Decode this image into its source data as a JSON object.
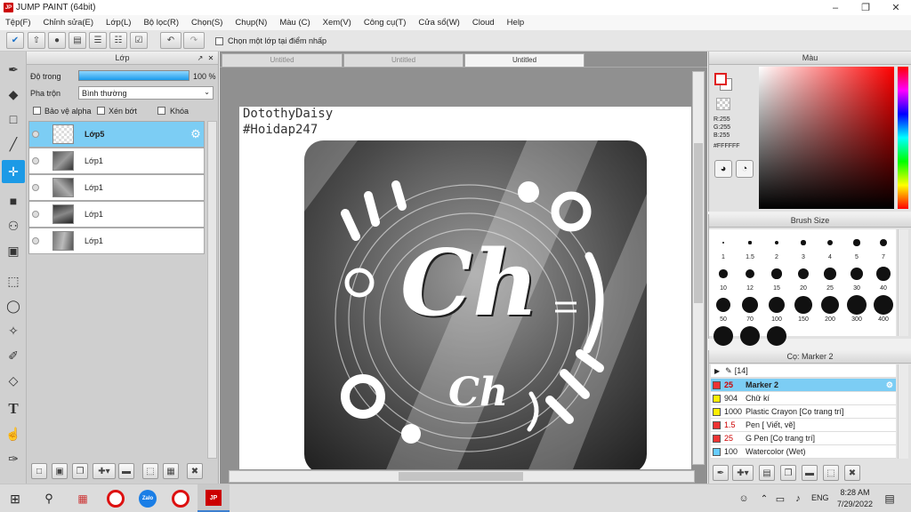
{
  "app": {
    "title": "JUMP PAINT (64bit)",
    "logo_text": "JP"
  },
  "menu": [
    "Tệp(F)",
    "Chỉnh sửa(E)",
    "Lớp(L)",
    "Bộ lọc(R)",
    "Chọn(S)",
    "Chụp(N)",
    "Màu (C)",
    "Xem(V)",
    "Công cụ(T)",
    "Cửa sổ(W)",
    "Cloud",
    "Help"
  ],
  "toolbar": {
    "sample_label": "Chọn một lớp tại điểm nhấp"
  },
  "layer_panel": {
    "title": "Lớp",
    "opacity_label": "Độ trong",
    "opacity_value": "100 %",
    "opacity_level": 1.0,
    "blend_label": "Pha trộn",
    "blend_value": "Bình thường",
    "protect_alpha": "Bảo vệ alpha",
    "clipping": "Xén bớt",
    "lock": "Khóa",
    "layers": [
      {
        "name": "Lớp5"
      },
      {
        "name": "Lớp1"
      },
      {
        "name": "Lớp1"
      },
      {
        "name": "Lớp1"
      },
      {
        "name": "Lớp1"
      }
    ]
  },
  "doc": {
    "tabs": [
      "Untitled",
      "Untitled",
      "Untitled"
    ],
    "signature": [
      "DotothyDaisy",
      "#Hoidap247"
    ],
    "art_text_big": "Ch",
    "art_text_small": "Ch"
  },
  "color_panel": {
    "title": "Màu",
    "r": "R:255",
    "g": "G:255",
    "b": "B:255",
    "hex": "#FFFFFF"
  },
  "brush_size": {
    "title": "Brush Size",
    "sizes": [
      "1",
      "1.5",
      "2",
      "3",
      "4",
      "5",
      "7",
      "10",
      "12",
      "15",
      "20",
      "25",
      "30",
      "40",
      "50",
      "70",
      "100",
      "150",
      "200",
      "300",
      "400",
      "",
      "",
      ""
    ]
  },
  "brush_list": {
    "title": "Cọ: Marker 2",
    "group": "[14]",
    "items": [
      {
        "size": "25",
        "name": "Marker 2",
        "color": "#ee3333"
      },
      {
        "size": "904",
        "name": "Chữ kí",
        "color": "#ffee00"
      },
      {
        "size": "1000",
        "name": "Plastic Crayon [Cọ trang trí]",
        "color": "#ffee00"
      },
      {
        "size": "1.5",
        "name": "Pen [ Viết, vẽ]",
        "color": "#ee3333"
      },
      {
        "size": "25",
        "name": "G Pen [Cọ trang trí]",
        "color": "#ee3333"
      },
      {
        "size": "100",
        "name": "Watercolor (Wet)",
        "color": "#66ccff"
      }
    ]
  },
  "taskbar": {
    "time": "8:28 AM",
    "date": "7/29/2022",
    "lang": "ENG",
    "zalo": "Zalo"
  }
}
